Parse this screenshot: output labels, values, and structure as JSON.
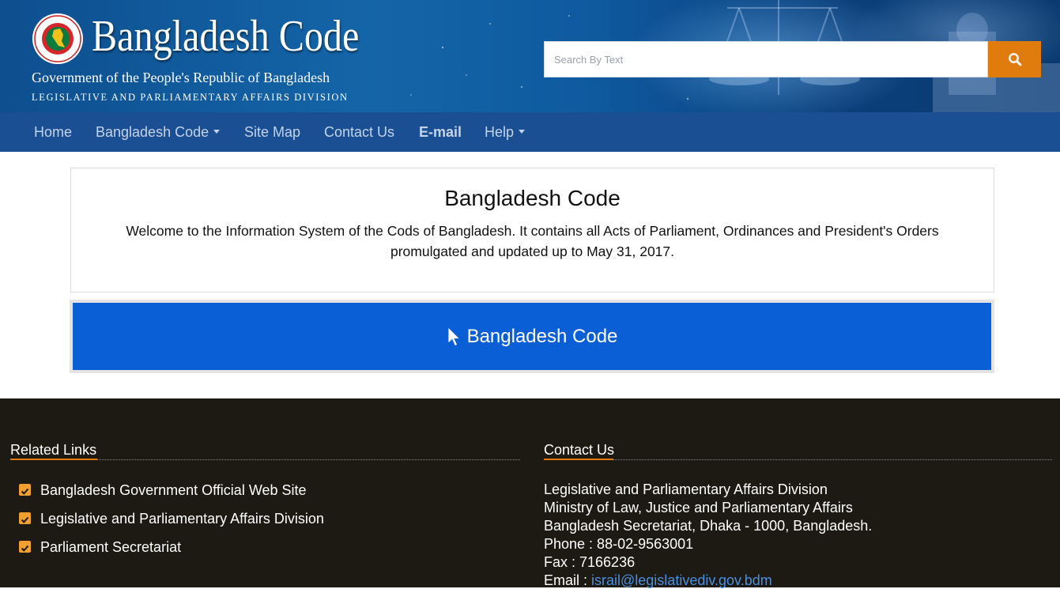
{
  "header": {
    "title": "Bangladesh Code",
    "subtitle": "Government of the People's Republic of Bangladesh",
    "division": "LEGISLATIVE AND PARLIAMENTARY AFFAIRS DIVISION",
    "logo_icon": "bangladesh-emblem-icon"
  },
  "search": {
    "placeholder": "Search By Text",
    "value": "",
    "button_icon": "search-icon",
    "button_color": "#e07b0e"
  },
  "nav": {
    "items": [
      {
        "label": "Home",
        "dropdown": false
      },
      {
        "label": "Bangladesh Code",
        "dropdown": true
      },
      {
        "label": "Site Map",
        "dropdown": false
      },
      {
        "label": "Contact Us",
        "dropdown": false
      },
      {
        "label": "E-mail",
        "dropdown": false,
        "bold": true
      },
      {
        "label": "Help",
        "dropdown": true
      }
    ],
    "bar_color": "#1a4f94"
  },
  "main": {
    "title": "Bangladesh Code",
    "description_line1": "Welcome to the Information System of the Cods of Bangladesh. It contains all Acts of Parliament, Ordinances and President's Orders",
    "description_line2": "promulgated and updated up to May 31, 2017.",
    "button_label": "Bangladesh Code",
    "button_icon": "pointer-cursor-icon",
    "button_color": "#0a5fd6"
  },
  "footer": {
    "related_links": {
      "heading": "Related Links",
      "items": [
        "Bangladesh Government Official Web Site",
        "Legislative and Parliamentary Affairs Division",
        "Parliament Secretariat"
      ]
    },
    "contact": {
      "heading": "Contact Us",
      "lines": [
        "Legislative and Parliamentary Affairs Division",
        "Ministry of Law, Justice and Parliamentary Affairs",
        "Bangladesh Secretariat, Dhaka - 1000, Bangladesh.",
        "Phone : 88-02-9563001",
        "Fax : 7166236"
      ],
      "email_label": "Email : ",
      "email": "israil@legislativediv.gov.bdm"
    },
    "accent_color": "#e07b0e"
  }
}
